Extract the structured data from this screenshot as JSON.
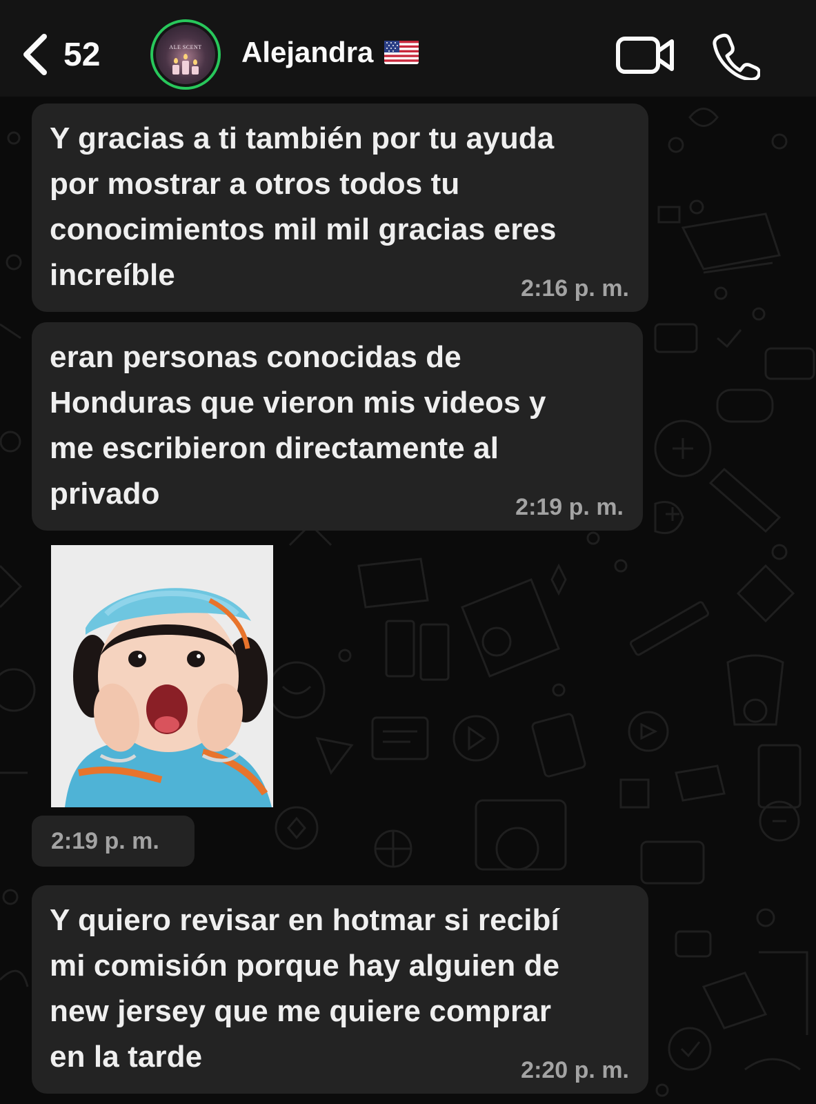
{
  "header": {
    "back_count": "52",
    "contact_name": "Alejandra",
    "avatar_text": "ALE SCENT",
    "status_ring_color": "#28c75b",
    "icons": [
      "chevron-left-icon",
      "video-call-icon",
      "phone-icon",
      "us-flag-icon"
    ]
  },
  "messages": [
    {
      "text": "Y gracias a ti también por tu ayuda\npor mostrar a otros todos tu\nconocimientos mil mil gracias eres\nincreíble",
      "time": "2:16 p. m."
    },
    {
      "text": "eran personas conocidas de\nHonduras que vieron mis videos y\nme escribieron directamente al\nprivado",
      "time": "2:19 p. m."
    },
    {
      "type": "image",
      "description": "sticker of surprised toddler",
      "time": "2:19 p. m."
    },
    {
      "text": "Y quiero revisar en hotmar si recibí\nmi comisión porque hay alguien de\nnew jersey que me quiere comprar\nen la tarde",
      "time": "2:20 p. m."
    }
  ],
  "colors": {
    "background": "#0b0b0b",
    "bubble": "#232323",
    "header": "#141414",
    "accent": "#28c75b"
  }
}
